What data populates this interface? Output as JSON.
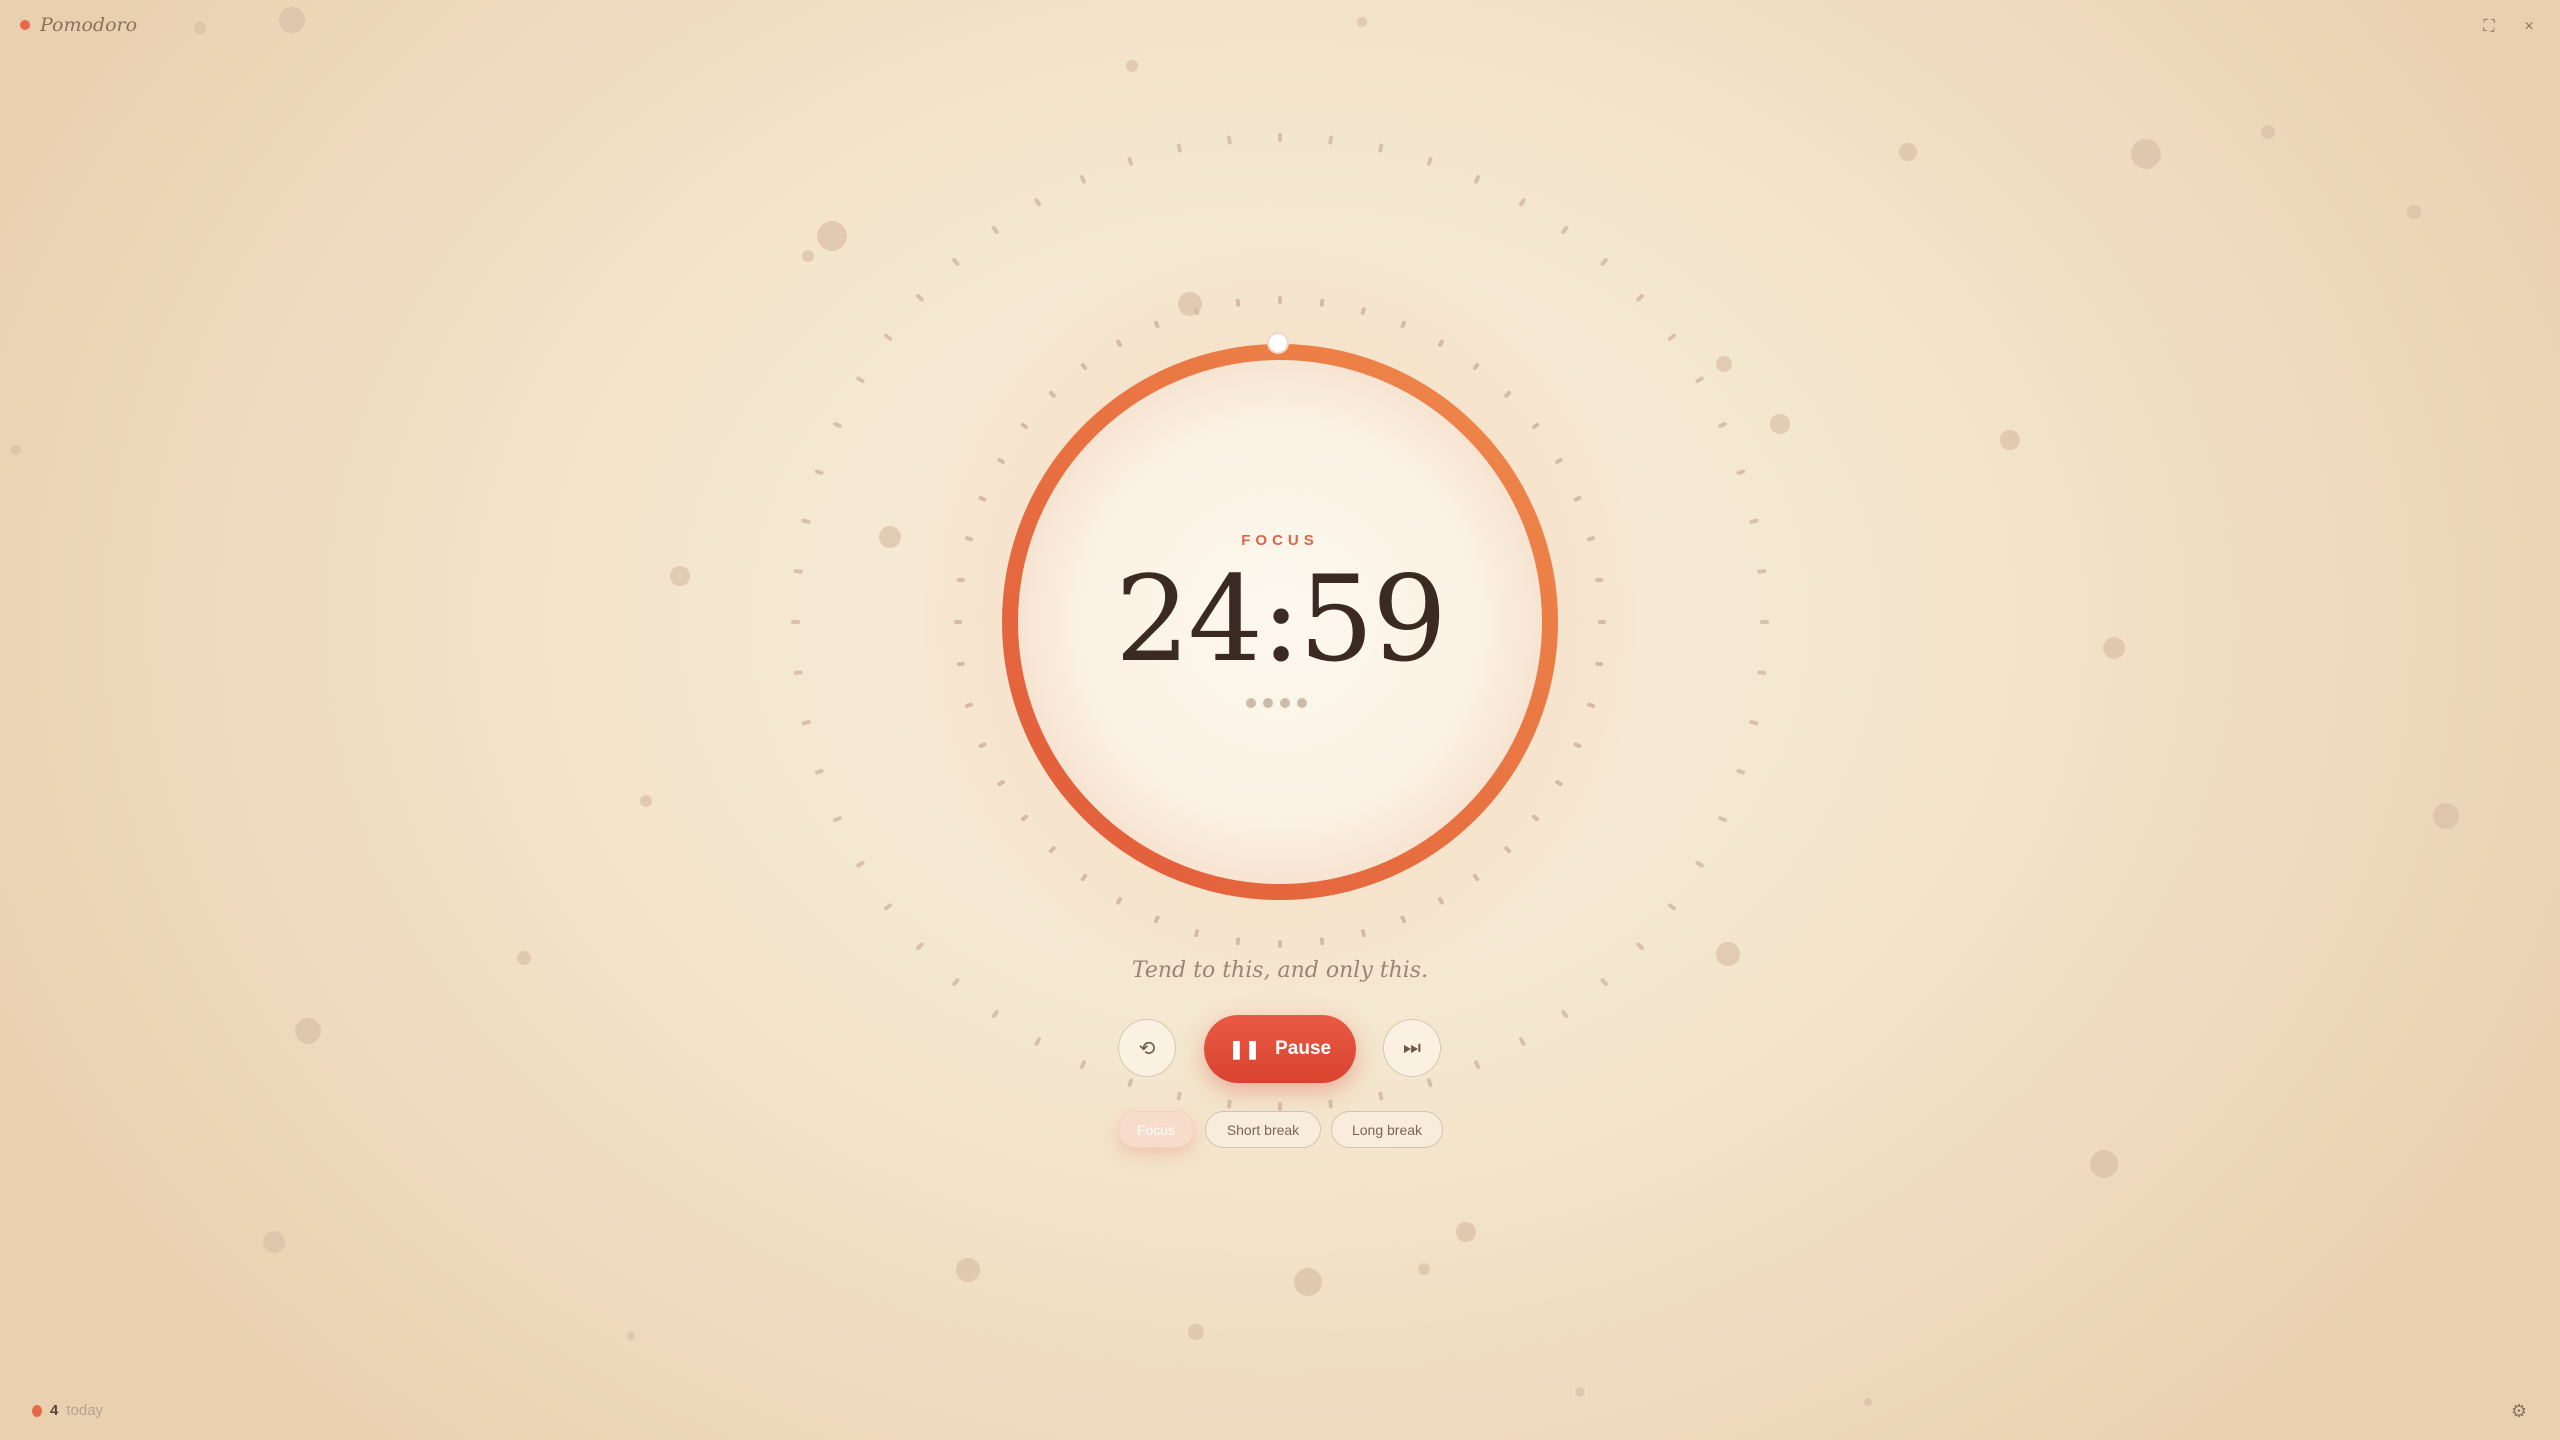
{
  "app": {
    "title": "Pomodoro"
  },
  "window": {
    "fullscreen_icon": "⛶",
    "close_icon": "×"
  },
  "timer": {
    "mode_label": "FOCUS",
    "time": "24:59",
    "progress": 0.0,
    "session_dots": 4,
    "tagline": "Tend to this, and only this."
  },
  "controls": {
    "reset_icon": "⟲",
    "pause_icon": "❚❚",
    "pause_label": "Pause",
    "skip_icon": "⏭"
  },
  "modes": [
    {
      "label": "Focus",
      "active": true
    },
    {
      "label": "Short break",
      "active": false
    },
    {
      "label": "Long break",
      "active": false
    }
  ],
  "stats": {
    "count": "4",
    "label": "today"
  },
  "settings": {
    "icon": "⚙"
  },
  "colors": {
    "accent": "#e8674a",
    "ring_start": "#e15a3a",
    "ring_end": "#ef8a4a",
    "pause_button": "#e04e3a"
  }
}
